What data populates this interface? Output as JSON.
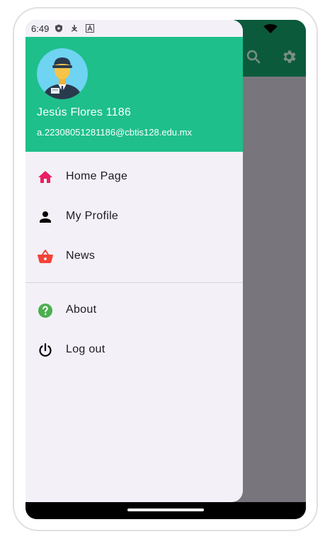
{
  "status_bar": {
    "time": "6:49"
  },
  "drawer": {
    "account": {
      "name": "Jesús Flores 1186",
      "email": "a.22308051281186@cbtis128.edu.mx"
    },
    "menu_primary": [
      {
        "label": "Home Page",
        "icon": "home-icon",
        "color": "#e91e63"
      },
      {
        "label": "My Profile",
        "icon": "person-icon",
        "color": "#000000"
      },
      {
        "label": "News",
        "icon": "basket-icon",
        "color": "#f44336"
      }
    ],
    "menu_secondary": [
      {
        "label": "About",
        "icon": "help-icon",
        "color": "#4caf50"
      },
      {
        "label": "Log out",
        "icon": "power-icon",
        "color": "#000000"
      }
    ]
  },
  "app_bar": {
    "actions": [
      "search-icon",
      "gear-icon"
    ]
  },
  "colors": {
    "header": "#1ebf8b",
    "app_bar_dimmed": "#0c5a3c",
    "drawer_bg": "#f3f1f7",
    "scrim": "#77757b"
  }
}
